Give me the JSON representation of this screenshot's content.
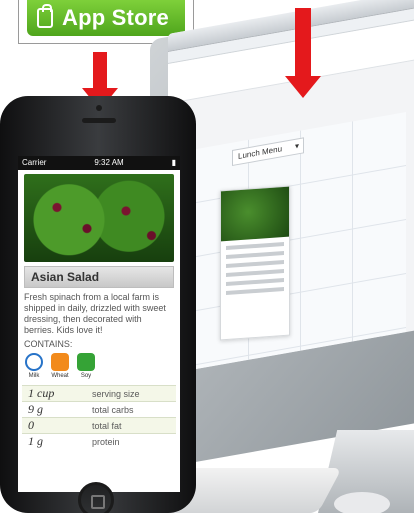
{
  "badge": {
    "label": "App Store",
    "icon": "shopping-bag-icon",
    "color": "#5bb624"
  },
  "arrows": {
    "color": "#e4191c"
  },
  "phone": {
    "status": {
      "carrier": "Carrier",
      "time": "9:32 AM"
    },
    "food": {
      "title": "Asian Salad",
      "description": "Fresh spinach from a local farm is shipped in daily, drizzled with sweet dressing, then decorated with berries. Kids love it!",
      "contains_label": "CONTAINS:",
      "allergens": [
        {
          "name": "Milk",
          "icon": "milk-icon"
        },
        {
          "name": "Wheat",
          "icon": "wheat-icon"
        },
        {
          "name": "Soy",
          "icon": "soy-icon"
        }
      ],
      "nutrition": [
        {
          "amount": "1 cup",
          "label": "serving size"
        },
        {
          "amount": "9 g",
          "label": "total carbs"
        },
        {
          "amount": "0",
          "label": "total fat"
        },
        {
          "amount": "1 g",
          "label": "protein"
        }
      ]
    }
  },
  "desktop": {
    "menu_select": "Lunch Menu"
  }
}
